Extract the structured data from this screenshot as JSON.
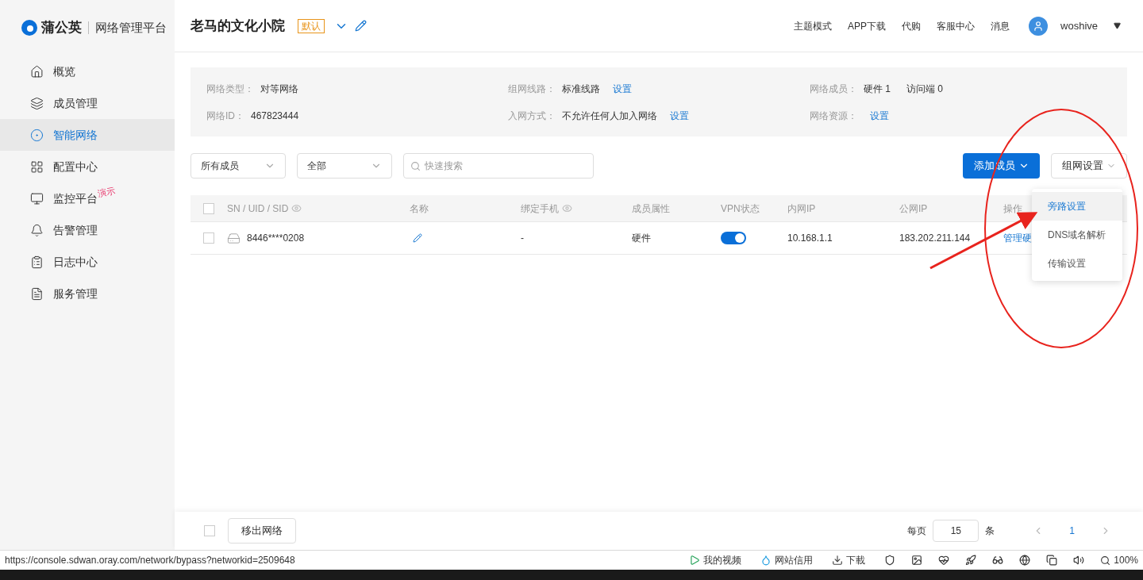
{
  "brand": {
    "name": "蒲公英",
    "subtitle": "网络管理平台"
  },
  "sidebar": {
    "items": [
      {
        "label": "概览",
        "selected": false
      },
      {
        "label": "成员管理",
        "selected": false
      },
      {
        "label": "智能网络",
        "selected": true
      },
      {
        "label": "配置中心",
        "selected": false
      },
      {
        "label": "监控平台",
        "selected": false,
        "badge": "演示"
      },
      {
        "label": "告警管理",
        "selected": false
      },
      {
        "label": "日志中心",
        "selected": false
      },
      {
        "label": "服务管理",
        "selected": false
      }
    ]
  },
  "header": {
    "network_name": "老马的文化小院",
    "tag": "默认",
    "nav": [
      "主题模式",
      "APP下载",
      "代购",
      "客服中心",
      "消息"
    ],
    "user": "woshive"
  },
  "info": [
    {
      "label": "网络类型：",
      "value": "对等网络"
    },
    {
      "label": "组网线路：",
      "value": "标准线路",
      "link": "设置"
    },
    {
      "label": "网络成员：",
      "value": "硬件 1",
      "extra": "访问端 0"
    },
    {
      "label": "网络ID：",
      "value": "467823444"
    },
    {
      "label": "入网方式：",
      "value": "不允许任何人加入网络",
      "link": "设置"
    },
    {
      "label": "网络资源：",
      "link": "设置"
    }
  ],
  "filters": {
    "member_select": "所有成员",
    "status_select": "全部",
    "search_placeholder": "快速搜索"
  },
  "buttons": {
    "add_member": "添加成员",
    "network_settings": "组网设置",
    "remove": "移出网络"
  },
  "footer_checked": false,
  "dropdown": [
    {
      "label": "旁路设置",
      "selected": true
    },
    {
      "label": "DNS域名解析",
      "selected": false
    },
    {
      "label": "传输设置",
      "selected": false
    }
  ],
  "table": {
    "select_all_checked": false,
    "columns": [
      "SN / UID / SID",
      "名称",
      "绑定手机",
      "成员属性",
      "VPN状态",
      "内网IP",
      "公网IP",
      "操作"
    ],
    "rows": [
      {
        "checked": false,
        "sn": "8446****0208",
        "phone": "-",
        "type": "硬件",
        "vpn_on": true,
        "lan_ip": "10.168.1.1",
        "wan_ip": "183.202.211.144",
        "action": "管理硬"
      }
    ]
  },
  "pagination": {
    "per_page_label": "每页",
    "per_page": "15",
    "unit": "条",
    "page": "1"
  },
  "status_bar": {
    "url": "https://console.sdwan.oray.com/network/bypass?networkid=2509648",
    "items": [
      "我的视频",
      "网站信用",
      "下載"
    ],
    "zoom": "100%"
  }
}
